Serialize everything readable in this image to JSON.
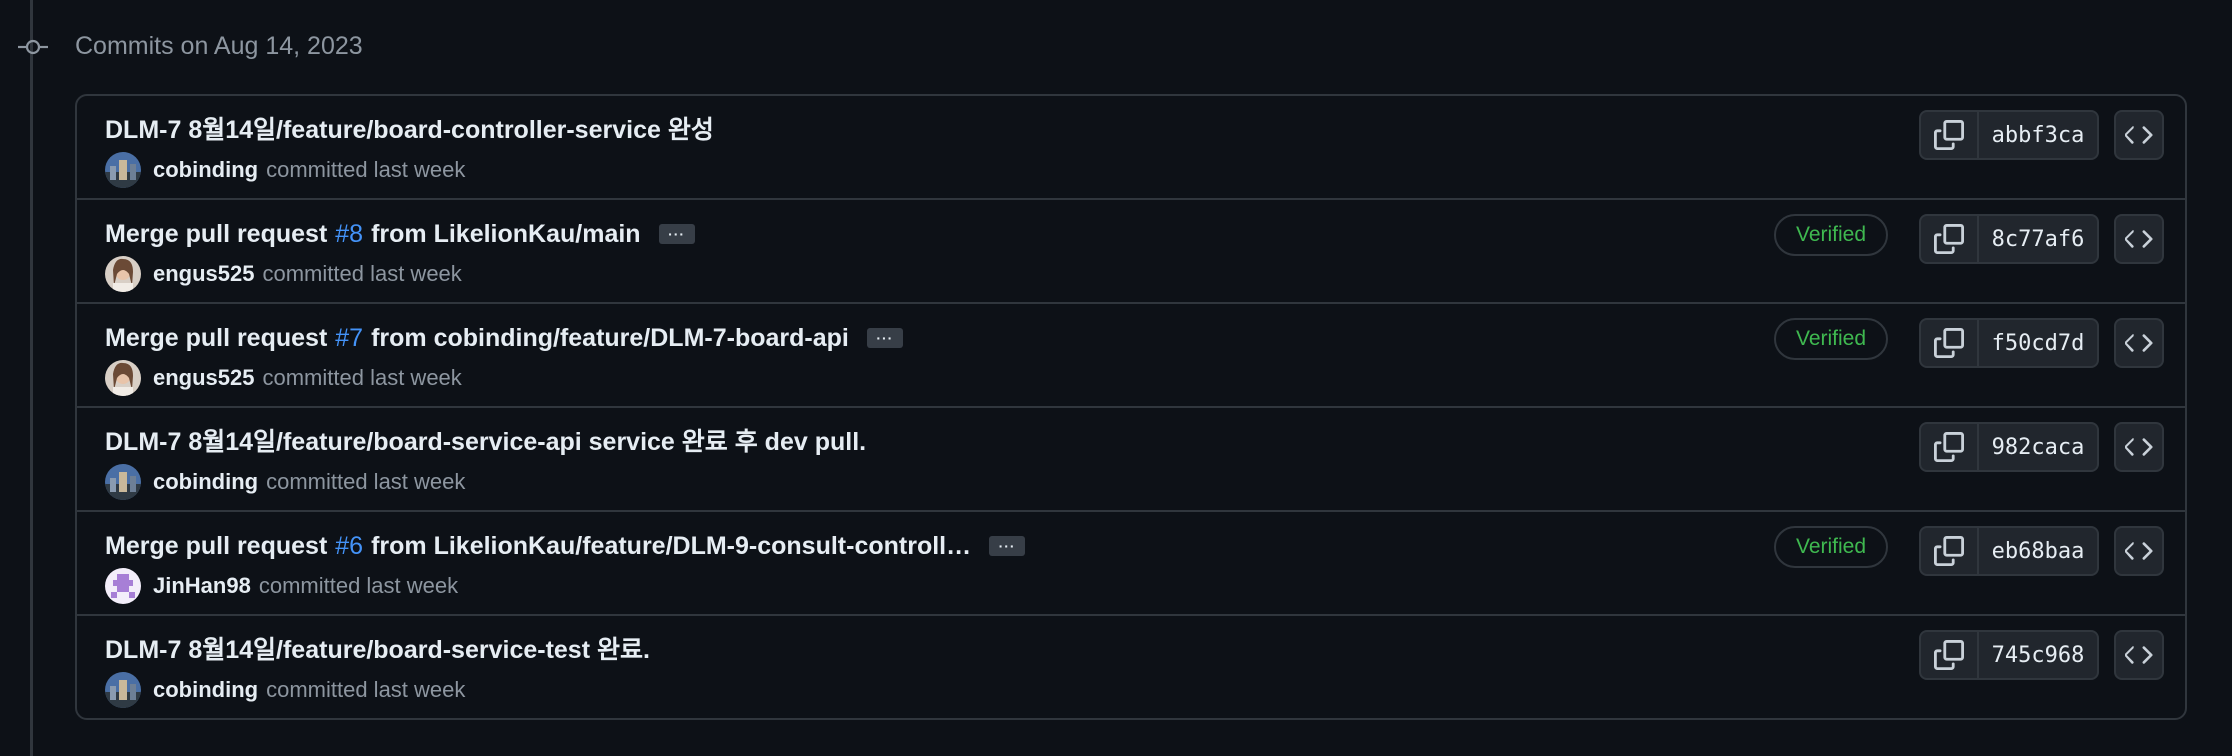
{
  "group": {
    "title": "Commits on Aug 14, 2023"
  },
  "commits": [
    {
      "title_pre": "DLM-7 8월14일/feature/board-controller-service 완성",
      "pr": "",
      "title_post": "",
      "has_ellipsis": false,
      "author": "cobinding",
      "avatar": "cobinding-avatar",
      "meta": "committed last week",
      "verified": "",
      "sha": "abbf3ca"
    },
    {
      "title_pre": "Merge pull request",
      "pr": "#8",
      "title_post": "from LikelionKau/main",
      "has_ellipsis": true,
      "author": "engus525",
      "avatar": "engus525-avatar",
      "meta": "committed last week",
      "verified": "Verified",
      "sha": "8c77af6"
    },
    {
      "title_pre": "Merge pull request",
      "pr": "#7",
      "title_post": "from cobinding/feature/DLM-7-board-api",
      "has_ellipsis": true,
      "author": "engus525",
      "avatar": "engus525-avatar",
      "meta": "committed last week",
      "verified": "Verified",
      "sha": "f50cd7d"
    },
    {
      "title_pre": "DLM-7 8월14일/feature/board-service-api service 완료 후 dev pull.",
      "pr": "",
      "title_post": "",
      "has_ellipsis": false,
      "author": "cobinding",
      "avatar": "cobinding-avatar",
      "meta": "committed last week",
      "verified": "",
      "sha": "982caca"
    },
    {
      "title_pre": "Merge pull request",
      "pr": "#6",
      "title_post": "from LikelionKau/feature/DLM-9-consult-controll…",
      "has_ellipsis": true,
      "author": "JinHan98",
      "avatar": "jinhan98-avatar",
      "meta": "committed last week",
      "verified": "Verified",
      "sha": "eb68baa"
    },
    {
      "title_pre": "DLM-7 8월14일/feature/board-service-test 완료.",
      "pr": "",
      "title_post": "",
      "has_ellipsis": false,
      "author": "cobinding",
      "avatar": "cobinding-avatar",
      "meta": "committed last week",
      "verified": "",
      "sha": "745c968"
    }
  ],
  "icons": {
    "timeline": "git-commit-icon",
    "copy": "copy-icon",
    "browse": "code-icon",
    "ellipsis": "ellipsis-icon"
  },
  "colors": {
    "background": "#0d1117",
    "border": "#30363d",
    "text": "#e6edf3",
    "muted": "#8d96a0",
    "link": "#4493f8",
    "verified": "#3fb950"
  }
}
